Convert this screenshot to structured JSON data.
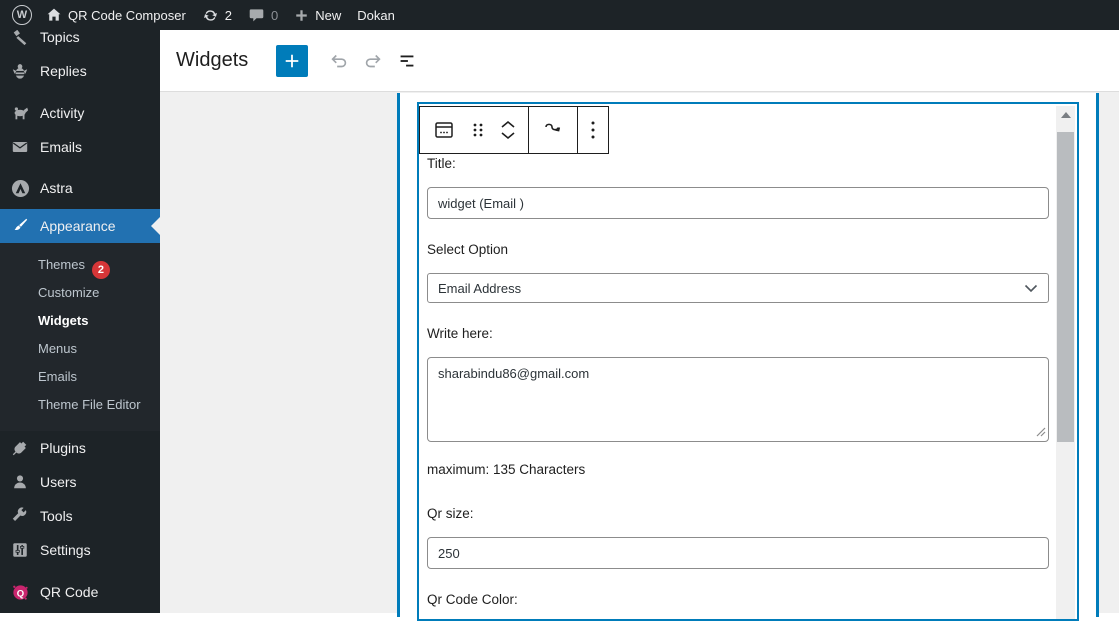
{
  "admin_bar": {
    "site_name": "QR Code Composer",
    "updates_count": "2",
    "comments_count": "0",
    "new_label": "New",
    "dokan_label": "Dokan"
  },
  "sidebar": {
    "items": [
      {
        "label": "Topics"
      },
      {
        "label": "Replies"
      },
      {
        "label": "Activity"
      },
      {
        "label": "Emails"
      },
      {
        "label": "Astra"
      },
      {
        "label": "Appearance"
      },
      {
        "label": "Plugins"
      },
      {
        "label": "Users"
      },
      {
        "label": "Tools"
      },
      {
        "label": "Settings"
      },
      {
        "label": "QR Code"
      }
    ],
    "appearance_submenu": [
      {
        "label": "Themes",
        "badge": "2"
      },
      {
        "label": "Customize"
      },
      {
        "label": "Widgets"
      },
      {
        "label": "Menus"
      },
      {
        "label": "Emails"
      },
      {
        "label": "Theme File Editor"
      }
    ]
  },
  "header": {
    "title": "Widgets"
  },
  "widget_form": {
    "title_label": "Title:",
    "title_value": "widget (Email )",
    "select_label": "Select Option",
    "select_value": "Email Address",
    "write_label": "Write here:",
    "write_value": "sharabindu86@gmail.com",
    "max_note": "maximum: 135 Characters",
    "qr_size_label": "Qr size:",
    "qr_size_value": "250",
    "qr_color_label": "Qr Code Color:"
  },
  "colors": {
    "admin_bar_bg": "#1d2327",
    "menu_active_bg": "#2271b1",
    "selection_blue": "#007cba",
    "badge_red": "#d63638",
    "qr_brand_pink": "#c9256e"
  }
}
